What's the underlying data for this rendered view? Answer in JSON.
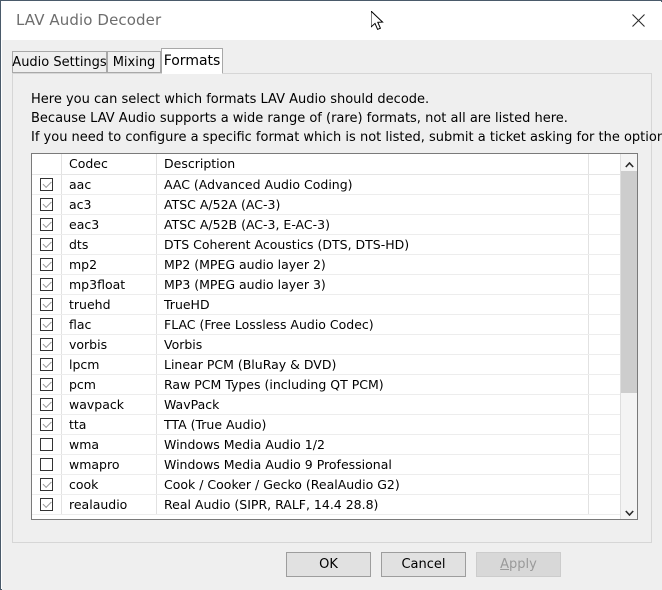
{
  "window": {
    "title": "LAV Audio Decoder",
    "close_icon": "close-icon"
  },
  "tabs": [
    {
      "label": "Audio Settings",
      "selected": false
    },
    {
      "label": "Mixing",
      "selected": false
    },
    {
      "label": "Formats",
      "selected": true
    }
  ],
  "description": {
    "line1": "Here you can select which formats LAV Audio should decode.",
    "line2": "Because LAV Audio supports a wide range of (rare) formats, not all are listed here.",
    "line3": "If you need to configure a specific format which is not listed, submit a ticket asking for the option."
  },
  "listview": {
    "columns": {
      "check": "",
      "codec": "Codec",
      "description": "Description"
    },
    "rows": [
      {
        "checked": true,
        "codec": "aac",
        "description": "AAC (Advanced Audio Coding)"
      },
      {
        "checked": true,
        "codec": "ac3",
        "description": "ATSC A/52A (AC-3)"
      },
      {
        "checked": true,
        "codec": "eac3",
        "description": "ATSC A/52B (AC-3, E-AC-3)"
      },
      {
        "checked": true,
        "codec": "dts",
        "description": "DTS Coherent Acoustics (DTS, DTS-HD)"
      },
      {
        "checked": true,
        "codec": "mp2",
        "description": "MP2 (MPEG audio layer 2)"
      },
      {
        "checked": true,
        "codec": "mp3float",
        "description": "MP3 (MPEG audio layer 3)"
      },
      {
        "checked": true,
        "codec": "truehd",
        "description": "TrueHD"
      },
      {
        "checked": true,
        "codec": "flac",
        "description": "FLAC (Free Lossless Audio Codec)"
      },
      {
        "checked": true,
        "codec": "vorbis",
        "description": "Vorbis"
      },
      {
        "checked": true,
        "codec": "lpcm",
        "description": "Linear PCM (BluRay & DVD)"
      },
      {
        "checked": true,
        "codec": "pcm",
        "description": "Raw PCM Types (including QT PCM)"
      },
      {
        "checked": true,
        "codec": "wavpack",
        "description": "WavPack"
      },
      {
        "checked": true,
        "codec": "tta",
        "description": "TTA (True Audio)"
      },
      {
        "checked": false,
        "codec": "wma",
        "description": "Windows Media Audio 1/2"
      },
      {
        "checked": false,
        "codec": "wmapro",
        "description": "Windows Media Audio 9 Professional"
      },
      {
        "checked": true,
        "codec": "cook",
        "description": "Cook / Cooker / Gecko (RealAudio G2)"
      },
      {
        "checked": true,
        "codec": "realaudio",
        "description": "Real Audio (SIPR, RALF, 14.4 28.8)"
      }
    ],
    "scrollbar": {
      "up_icon": "chevron-up-icon",
      "down_icon": "chevron-down-icon"
    }
  },
  "buttons": {
    "ok": "OK",
    "cancel": "Cancel",
    "apply_accel": "A",
    "apply_rest": "pply",
    "apply_enabled": false
  }
}
